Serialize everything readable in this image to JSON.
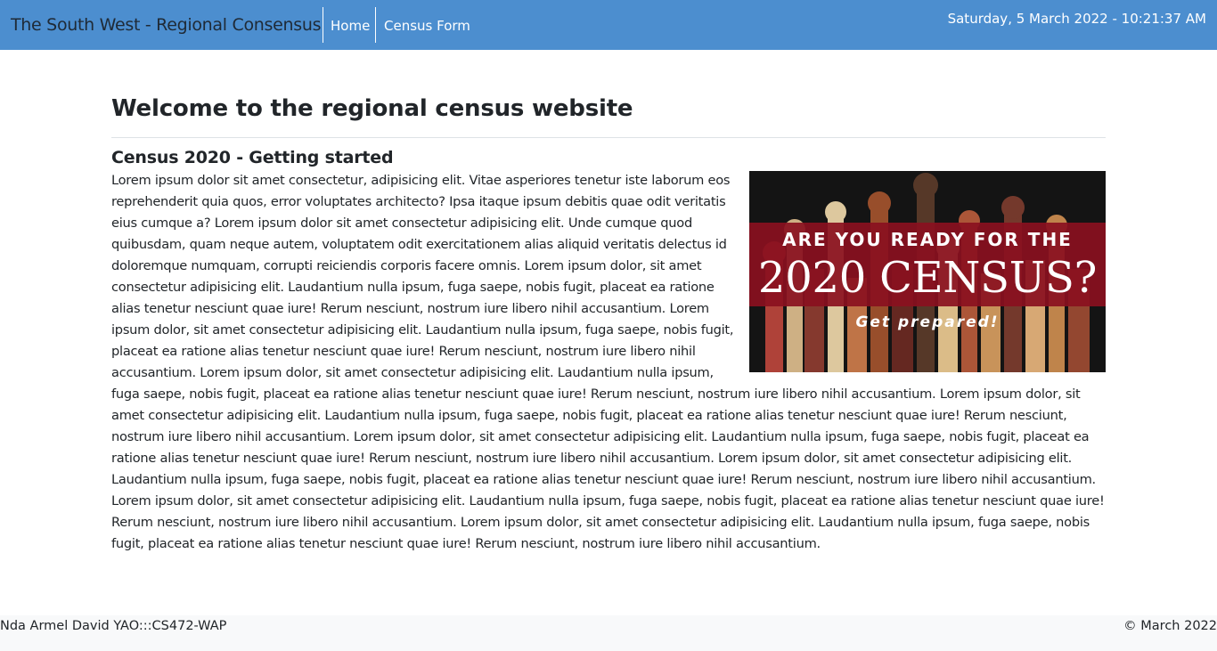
{
  "navbar": {
    "brand": "The South West - Regional Consensus",
    "links": [
      {
        "label": "Home"
      },
      {
        "label": "Census Form"
      }
    ],
    "datetime": "Saturday, 5 March 2022 - 10:21:37 AM",
    "background": "#4c8ecf"
  },
  "main": {
    "title": "Welcome to the regional census website",
    "subtitle": "Census 2020 - Getting started",
    "body": "Lorem ipsum dolor sit amet consectetur, adipisicing elit. Vitae asperiores tenetur iste laborum eos reprehenderit quia quos, error voluptates architecto? Ipsa itaque ipsum debitis quae odit veritatis eius cumque a? Lorem ipsum dolor sit amet consectetur adipisicing elit. Unde cumque quod quibusdam, quam neque autem, voluptatem odit exercitationem alias aliquid veritatis delectus id doloremque numquam, corrupti reiciendis corporis facere omnis. Lorem ipsum dolor, sit amet consectetur adipisicing elit. Laudantium nulla ipsum, fuga saepe, nobis fugit, placeat ea ratione alias tenetur nesciunt quae iure! Rerum nesciunt, nostrum iure libero nihil accusantium. Lorem ipsum dolor, sit amet consectetur adipisicing elit. Laudantium nulla ipsum, fuga saepe, nobis fugit, placeat ea ratione alias tenetur nesciunt quae iure! Rerum nesciunt, nostrum iure libero nihil accusantium. Lorem ipsum dolor, sit amet consectetur adipisicing elit. Laudantium nulla ipsum, fuga saepe, nobis fugit, placeat ea ratione alias tenetur nesciunt quae iure! Rerum nesciunt, nostrum iure libero nihil accusantium. Lorem ipsum dolor, sit amet consectetur adipisicing elit. Laudantium nulla ipsum, fuga saepe, nobis fugit, placeat ea ratione alias tenetur nesciunt quae iure! Rerum nesciunt, nostrum iure libero nihil accusantium. Lorem ipsum dolor, sit amet consectetur adipisicing elit. Laudantium nulla ipsum, fuga saepe, nobis fugit, placeat ea ratione alias tenetur nesciunt quae iure! Rerum nesciunt, nostrum iure libero nihil accusantium. Lorem ipsum dolor, sit amet consectetur adipisicing elit. Laudantium nulla ipsum, fuga saepe, nobis fugit, placeat ea ratione alias tenetur nesciunt quae iure! Rerum nesciunt, nostrum iure libero nihil accusantium. Lorem ipsum dolor, sit amet consectetur adipisicing elit. Laudantium nulla ipsum, fuga saepe, nobis fugit, placeat ea ratione alias tenetur nesciunt quae iure! Rerum nesciunt, nostrum iure libero nihil accusantium. Lorem ipsum dolor, sit amet consectetur adipisicing elit. Laudantium nulla ipsum, fuga saepe, nobis fugit, placeat ea ratione alias tenetur nesciunt quae iure! Rerum nesciunt, nostrum iure libero nihil accusantium.",
    "banner": {
      "line1": "ARE YOU READY FOR THE",
      "line2": "2020 CENSUS?",
      "line3": "Get prepared!",
      "band_color": "#8a1020"
    }
  },
  "footer": {
    "left": "Nda Armel David YAO:::CS472-WAP",
    "right": "© March 2022"
  }
}
